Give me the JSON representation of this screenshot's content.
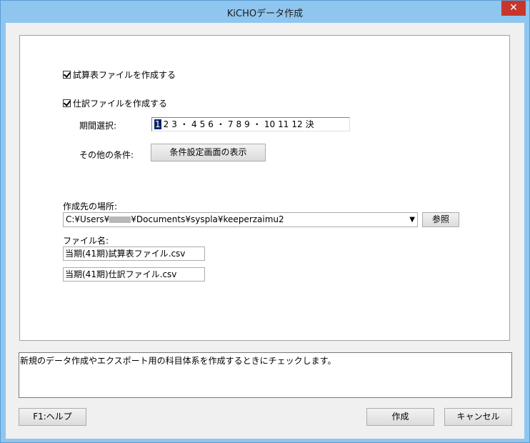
{
  "window": {
    "title": "KiCHOデータ作成",
    "close_symbol": "✕"
  },
  "options": {
    "trial_balance_label": "試算表ファイルを作成する",
    "journal_label": "仕訳ファイルを作成する",
    "period_label": "期間選択:",
    "periods": [
      "1",
      "2",
      "3",
      "・",
      "4",
      "5",
      "6",
      "・",
      "7",
      "8",
      "9",
      "・",
      "10",
      "11",
      "12",
      "決"
    ],
    "selected_period": "1",
    "other_conditions_label": "その他の条件:",
    "conditions_button": "条件設定画面の表示"
  },
  "destination": {
    "label": "作成先の場所:",
    "path_prefix": "C:¥Users¥",
    "path_suffix": "¥Documents¥syspla¥keeperzaimu2",
    "browse_button": "参照"
  },
  "files": {
    "label": "ファイル名:",
    "trial_balance_file": "当期(41期)試算表ファイル.csv",
    "journal_file": "当期(41期)仕訳ファイル.csv"
  },
  "description": "新規のデータ作成やエクスポート用の科目体系を作成するときにチェックします。",
  "footer": {
    "help_button": "F1:ヘルプ",
    "create_button": "作成",
    "cancel_button": "キャンセル"
  }
}
